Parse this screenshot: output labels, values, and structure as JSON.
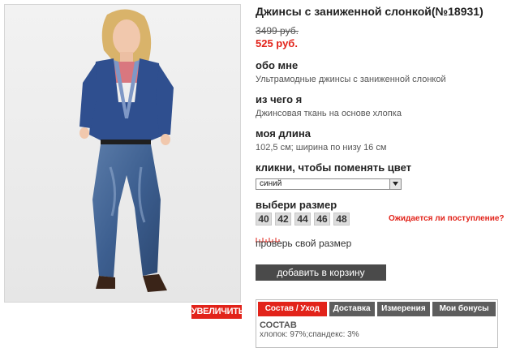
{
  "product": {
    "title": "Джинсы с заниженной слонкой(№18931)",
    "old_price": "3499 руб.",
    "new_price": "525 руб.",
    "zoom_label": "УВЕЛИЧИТЬ"
  },
  "about": {
    "heading": "обо мне",
    "text": "Ультрамодные джинсы с заниженной слонкой"
  },
  "material": {
    "heading": "из чего я",
    "text": "Джинсовая ткань на основе хлопка"
  },
  "length": {
    "heading": "моя длина",
    "text": "102,5 см; ширина по низу 16 см"
  },
  "color": {
    "heading": "кликни, чтобы поменять цвет",
    "selected": "синий"
  },
  "size": {
    "heading": "выбери размер",
    "options": [
      "40",
      "42",
      "44",
      "46",
      "48"
    ],
    "waiting_link": "Ожидается ли поступление?",
    "check_link": "проверь свой размер"
  },
  "cart": {
    "label": "добавить в корзину"
  },
  "tabs": {
    "items": [
      "Состав / Уход",
      "Доставка",
      "Измерения",
      "Мои бонусы"
    ],
    "active": 0
  },
  "composition": {
    "title": "СОСТАВ",
    "text": "хлопок: 97%;спандекс: 3%"
  },
  "colors": {
    "accent": "#e2231a",
    "dark_button": "#4a4a4a",
    "tab_bg": "#5d5d5d"
  }
}
